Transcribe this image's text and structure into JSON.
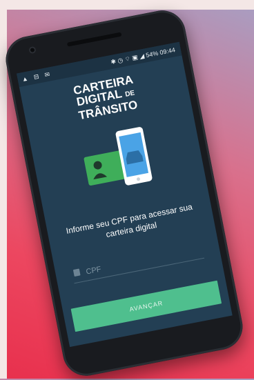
{
  "status_bar": {
    "left_icons": "▲ ⊟ ✉",
    "right_icons": "✱ ◷ ⌔ ▣ ◢",
    "battery": "54%",
    "time": "09:44"
  },
  "logo": {
    "line1": "CARTEIRA",
    "line2": "DIGITAL",
    "line2_small": "DE",
    "line3": "TRÂNSITO"
  },
  "prompt": "Informe seu CPF para acessar sua carteira digital",
  "cpf_field": {
    "placeholder": "CPF",
    "icon": "id-card-icon"
  },
  "continue_button": "AVANÇAR",
  "colors": {
    "screen": "#233f54",
    "accent_green": "#4fbf8e",
    "license_card": "#3fae5a",
    "phone_screen": "#4aa3e6"
  }
}
